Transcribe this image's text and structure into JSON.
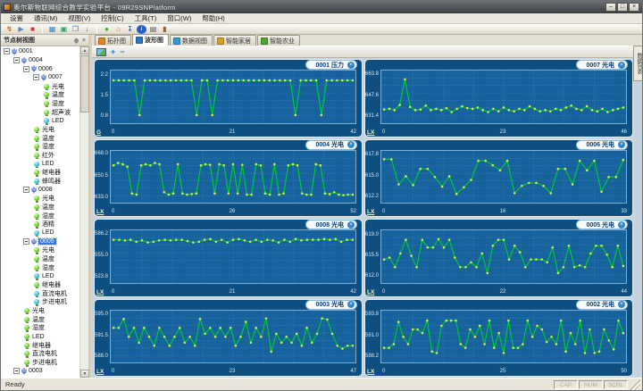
{
  "window": {
    "title": "奥尔斯物联网综合教学实验平台 - 09R29SNPlatform",
    "controls": [
      "–",
      "□",
      "×"
    ]
  },
  "menu": {
    "items": [
      "设置",
      "通讯(M)",
      "视图(V)",
      "控制(C)",
      "工具(T)",
      "窗口(W)",
      "帮助(H)"
    ]
  },
  "toolbar": {
    "icons": [
      {
        "name": "connect-icon",
        "glyph": "↯",
        "color": "#e05a10"
      },
      {
        "name": "run-icon",
        "glyph": "▶",
        "color": "#5b85b8"
      },
      {
        "name": "stop-icon",
        "glyph": "■",
        "color": "#c83232"
      },
      {
        "sep": true
      },
      {
        "name": "export-icon",
        "glyph": "▦",
        "color": "#2e8ac8"
      },
      {
        "name": "image-icon",
        "glyph": "▣",
        "color": "#3aa06a"
      },
      {
        "name": "window-icon",
        "glyph": "❐",
        "color": "#2e6fd0"
      },
      {
        "name": "download-icon",
        "glyph": "↓",
        "color": "#1e6fd8"
      },
      {
        "sep": true
      },
      {
        "name": "globe-icon",
        "glyph": "●",
        "color": "#38b020"
      },
      {
        "name": "home-icon",
        "glyph": "⌂",
        "color": "#d07818"
      },
      {
        "name": "update-icon",
        "glyph": "↧",
        "color": "#1e6fd8"
      },
      {
        "name": "info-icon",
        "glyph": "i",
        "color": "#ffffff",
        "bg": "#2060d0",
        "round": true
      },
      {
        "name": "keyboard-icon",
        "glyph": "▤",
        "color": "#555555"
      },
      {
        "name": "exit-icon",
        "glyph": "▮",
        "color": "#a05a28"
      }
    ]
  },
  "sidebar": {
    "title": "节点树视图",
    "items": [
      {
        "type": "node",
        "label": "0001",
        "level": 0,
        "expanded": true
      },
      {
        "type": "node",
        "label": "0004",
        "level": 1,
        "expanded": true
      },
      {
        "type": "node",
        "label": "0006",
        "level": 2,
        "expanded": true
      },
      {
        "type": "node",
        "label": "0007",
        "level": 3,
        "expanded": true
      },
      {
        "type": "sensor",
        "label": "光电",
        "level": 4,
        "icon": "g"
      },
      {
        "type": "sensor",
        "label": "温度",
        "level": 4,
        "icon": "g"
      },
      {
        "type": "sensor",
        "label": "湿度",
        "level": 4,
        "icon": "g"
      },
      {
        "type": "sensor",
        "label": "超声波",
        "level": 4,
        "icon": "g"
      },
      {
        "type": "sensor",
        "label": "LED",
        "level": 4,
        "icon": "c"
      },
      {
        "type": "sensor",
        "label": "光电",
        "level": 3,
        "icon": "g"
      },
      {
        "type": "sensor",
        "label": "温度",
        "level": 3,
        "icon": "g"
      },
      {
        "type": "sensor",
        "label": "湿度",
        "level": 3,
        "icon": "g"
      },
      {
        "type": "sensor",
        "label": "红外",
        "level": 3,
        "icon": "g"
      },
      {
        "type": "sensor",
        "label": "LED",
        "level": 3,
        "icon": "c"
      },
      {
        "type": "sensor",
        "label": "继电器",
        "level": 3,
        "icon": "g"
      },
      {
        "type": "sensor",
        "label": "蜂鸣器",
        "level": 3,
        "icon": "c"
      },
      {
        "type": "node",
        "label": "0008",
        "level": 2,
        "expanded": true
      },
      {
        "type": "sensor",
        "label": "光电",
        "level": 3,
        "icon": "g"
      },
      {
        "type": "sensor",
        "label": "温度",
        "level": 3,
        "icon": "g"
      },
      {
        "type": "sensor",
        "label": "湿度",
        "level": 3,
        "icon": "g"
      },
      {
        "type": "sensor",
        "label": "酒精",
        "level": 3,
        "icon": "g"
      },
      {
        "type": "sensor",
        "label": "LED",
        "level": 3,
        "icon": "c"
      },
      {
        "type": "node",
        "label": "0005",
        "level": 2,
        "expanded": true,
        "selected": true
      },
      {
        "type": "sensor",
        "label": "光电",
        "level": 3,
        "icon": "g"
      },
      {
        "type": "sensor",
        "label": "温度",
        "level": 3,
        "icon": "g"
      },
      {
        "type": "sensor",
        "label": "湿度",
        "level": 3,
        "icon": "g"
      },
      {
        "type": "sensor",
        "label": "LED",
        "level": 3,
        "icon": "c"
      },
      {
        "type": "sensor",
        "label": "继电器",
        "level": 3,
        "icon": "g"
      },
      {
        "type": "sensor",
        "label": "直流电机",
        "level": 3,
        "icon": "c"
      },
      {
        "type": "sensor",
        "label": "步进电机",
        "level": 3,
        "icon": "c"
      },
      {
        "type": "sensor",
        "label": "光电",
        "level": 2,
        "icon": "g"
      },
      {
        "type": "sensor",
        "label": "温度",
        "level": 2,
        "icon": "g"
      },
      {
        "type": "sensor",
        "label": "湿度",
        "level": 2,
        "icon": "g"
      },
      {
        "type": "sensor",
        "label": "LED",
        "level": 2,
        "icon": "g"
      },
      {
        "type": "sensor",
        "label": "继电器",
        "level": 2,
        "icon": "g"
      },
      {
        "type": "sensor",
        "label": "直流电机",
        "level": 2,
        "icon": "g"
      },
      {
        "type": "sensor",
        "label": "步进电机",
        "level": 2,
        "icon": "g"
      },
      {
        "type": "node",
        "label": "0003",
        "level": 1,
        "expanded": true
      }
    ]
  },
  "tabs": {
    "active_index": 1,
    "items": [
      {
        "label": "拓扑图",
        "icon_color": "#e08828"
      },
      {
        "label": "波形图",
        "icon_color": "#2878c8"
      },
      {
        "label": "数据视图",
        "icon_color": "#3a9ad8"
      },
      {
        "label": "智能家居",
        "icon_color": "#d8a020"
      },
      {
        "label": "智能农业",
        "icon_color": "#48a830"
      }
    ]
  },
  "subtoolbar": {
    "icons": [
      {
        "name": "snapshot-icon",
        "kind": "img"
      },
      {
        "name": "zoom-in-icon",
        "glyph": "+",
        "color": "#1e7ad4"
      },
      {
        "name": "zoom-out-icon",
        "glyph": "−",
        "color": "#1e7ad4"
      }
    ]
  },
  "side_tab": {
    "label": "数据列表"
  },
  "statusbar": {
    "left": "Ready",
    "indicators": [
      "CAP",
      "NUM",
      "SCRL"
    ]
  },
  "colors": {
    "panel_bg": "#0d4f80",
    "plot_bg": "#15629c",
    "grid": "#4d8cc0",
    "line": "#00c832",
    "marker": "#d6ee4e",
    "selection": "#3a78d0"
  },
  "chart_data": [
    {
      "type": "line",
      "node": "0001",
      "sensor": "压力",
      "title": "0001 压力",
      "unit": "G",
      "y_ticks": [
        "2.2",
        "1.5",
        "0.8"
      ],
      "y_tick_values": [
        2.2,
        1.5,
        0.8
      ],
      "x_ticks": [
        "0",
        "21",
        "42"
      ],
      "ylim": [
        0.68,
        2.32
      ],
      "values": [
        2.05,
        2.05,
        2.05,
        2.05,
        2.05,
        0.88,
        2.05,
        2.05,
        2.05,
        2.05,
        2.05,
        2.05,
        2.05,
        2.05,
        2.05,
        2.05,
        0.88,
        2.05,
        2.05,
        0.88,
        2.05,
        2.05,
        2.05,
        2.05,
        2.05,
        2.05,
        2.05,
        2.05,
        2.05,
        2.05,
        2.05,
        2.05,
        2.05,
        2.05,
        2.05,
        0.88,
        2.05,
        2.05,
        2.05,
        2.05,
        0.88,
        2.05,
        2.05,
        2.05,
        2.05,
        2.05,
        2.05
      ]
    },
    {
      "type": "line",
      "node": "0007",
      "sensor": "光电",
      "title": "0007 光电",
      "unit": "LX",
      "y_ticks": [
        "663.8",
        "647.6",
        "631.4"
      ],
      "y_tick_values": [
        663.8,
        647.6,
        631.4
      ],
      "x_ticks": [
        "0",
        "23",
        "46"
      ],
      "ylim": [
        628.5,
        666.5
      ],
      "values": [
        637.5,
        638,
        637,
        641,
        661,
        639.5,
        637,
        637.5,
        640.5,
        637,
        638,
        637,
        638.5,
        635.5,
        638,
        640,
        638.5,
        638,
        639,
        637,
        635.5,
        638,
        636,
        639,
        637,
        636,
        638,
        637,
        640,
        638,
        636,
        637,
        636,
        638,
        637,
        639,
        640.5,
        638,
        637,
        640,
        637,
        636,
        638,
        635.5,
        637,
        638,
        639
      ]
    },
    {
      "type": "line",
      "node": "0004",
      "sensor": "光电",
      "title": "0004 光电",
      "unit": "LX",
      "y_ticks": [
        "668.0",
        "650.5",
        "633.0"
      ],
      "y_tick_values": [
        668.0,
        650.5,
        633.0
      ],
      "x_ticks": [
        "0",
        "26",
        "52"
      ],
      "ylim": [
        630.5,
        670.5
      ],
      "values": [
        660,
        662,
        661,
        659,
        637,
        636,
        660,
        661,
        660,
        662,
        661,
        638,
        636,
        637,
        661,
        637,
        636,
        636.5,
        637,
        660,
        661,
        660.5,
        637,
        661,
        660,
        637,
        661,
        637,
        660.5,
        636,
        636,
        661,
        660,
        637,
        636,
        661,
        636,
        637,
        660,
        661,
        660,
        637,
        636,
        636,
        661,
        660,
        637,
        636.5,
        638,
        636,
        635.5,
        636,
        636
      ]
    },
    {
      "type": "line",
      "node": "0006",
      "sensor": "光电",
      "title": "0006 光电",
      "unit": "LX",
      "y_ticks": [
        "617.8",
        "615.0",
        "612.2"
      ],
      "y_tick_values": [
        617.8,
        615.0,
        612.2
      ],
      "x_ticks": [
        "0",
        "16",
        "33"
      ],
      "ylim": [
        611.7,
        618.3
      ],
      "values": [
        617.4,
        617.4,
        614.0,
        615.1,
        613.9,
        616.1,
        616.1,
        615.0,
        613.7,
        615.1,
        612.7,
        613.6,
        614.6,
        617.2,
        617.2,
        616.6,
        615.9,
        617.2,
        612.8,
        613.8,
        614.2,
        614.2,
        613.8,
        612.8,
        616.1,
        616.1,
        614.0,
        617.2,
        615.9,
        617.2,
        613.0,
        615.0,
        615.0,
        617.3
      ]
    },
    {
      "type": "line",
      "node": "0008",
      "sensor": "光电",
      "title": "0008 光电",
      "unit": "LX",
      "y_ticks": [
        "586.2",
        "555.0",
        "523.8"
      ],
      "y_tick_values": [
        586.2,
        555.0,
        523.8
      ],
      "x_ticks": [
        "0",
        "21",
        "42"
      ],
      "ylim": [
        518.5,
        591.5
      ],
      "values": [
        580,
        580,
        579,
        580,
        577,
        579,
        576,
        577,
        579,
        580,
        579,
        580,
        580,
        578,
        576,
        577,
        580,
        581,
        577,
        580,
        576,
        580,
        581,
        579,
        577,
        580,
        577,
        580,
        579,
        576,
        580,
        577,
        581,
        579,
        580,
        580,
        580,
        581,
        580,
        581,
        577,
        580,
        580
      ]
    },
    {
      "type": "line",
      "node": "0005",
      "sensor": "光电",
      "title": "0005 光电",
      "unit": "LX",
      "y_ticks": [
        "619.0",
        "615.5",
        "612.0"
      ],
      "y_tick_values": [
        619.0,
        615.5,
        612.0
      ],
      "x_ticks": [
        "0",
        "22",
        "44"
      ],
      "ylim": [
        611.4,
        619.6
      ],
      "values": [
        615.0,
        615.3,
        613.7,
        616.0,
        618.3,
        615.6,
        613.7,
        618.3,
        617.0,
        617.0,
        618.4,
        617.0,
        618.3,
        615.3,
        613.7,
        613.7,
        614.5,
        613.7,
        616.0,
        612.7,
        617.3,
        618.3,
        618.3,
        615.0,
        617.3,
        616.2,
        613.7,
        615.0,
        615.0,
        615.0,
        614.5,
        617.0,
        612.7,
        613.7,
        617.3,
        613.7,
        614.0,
        613.7,
        616.0,
        617.3,
        617.3,
        615.8,
        613.7,
        617.3,
        613.9
      ]
    },
    {
      "type": "line",
      "node": "0003",
      "sensor": "光电",
      "title": "0003 光电",
      "unit": "LX",
      "y_ticks": [
        "595.0",
        "591.5",
        "588.0"
      ],
      "y_tick_values": [
        595.0,
        591.5,
        588.0
      ],
      "x_ticks": [
        "0",
        "23",
        "47"
      ],
      "ylim": [
        587.4,
        595.6
      ],
      "values": [
        593.0,
        593.0,
        594.5,
        591.5,
        593.0,
        590.5,
        593.0,
        591.5,
        590.0,
        593.0,
        591.5,
        590.0,
        591.5,
        593.0,
        590.5,
        591.5,
        590.0,
        594.5,
        592.0,
        593.0,
        591.5,
        593.0,
        591.5,
        593.0,
        590.0,
        591.5,
        594.0,
        590.5,
        593.0,
        591.5,
        594.6,
        589.0,
        592.0,
        590.5,
        591.5,
        590.5,
        592.0,
        590.0,
        593.0,
        590.5,
        592.0,
        594.6,
        594.4,
        592.0,
        590.0,
        589.5,
        590.0,
        590.0
      ]
    },
    {
      "type": "line",
      "node": "0002",
      "sensor": "光电",
      "title": "0002 光电",
      "unit": "LX",
      "y_ticks": [
        "593.8",
        "591.0",
        "588.2"
      ],
      "y_tick_values": [
        593.8,
        591.0,
        588.2
      ],
      "x_ticks": [
        "0",
        "25",
        "50"
      ],
      "ylim": [
        587.7,
        594.3
      ],
      "values": [
        589.5,
        589.5,
        590.0,
        593.0,
        591.0,
        590.0,
        592.0,
        592.0,
        591.5,
        593.2,
        589.0,
        588.8,
        592.5,
        593.2,
        593.2,
        593.2,
        590.0,
        589.5,
        592.0,
        591.0,
        592.5,
        590.0,
        593.2,
        589.5,
        591.5,
        588.8,
        593.2,
        589.5,
        589.5,
        590.0,
        593.2,
        591.0,
        592.5,
        592.0,
        590.3,
        591.0,
        590.0,
        593.2,
        589.0,
        591.5,
        590.0,
        593.2,
        588.8,
        592.0,
        588.8,
        589.0,
        592.0,
        590.5,
        589.3,
        593.2,
        591.5
      ]
    }
  ]
}
